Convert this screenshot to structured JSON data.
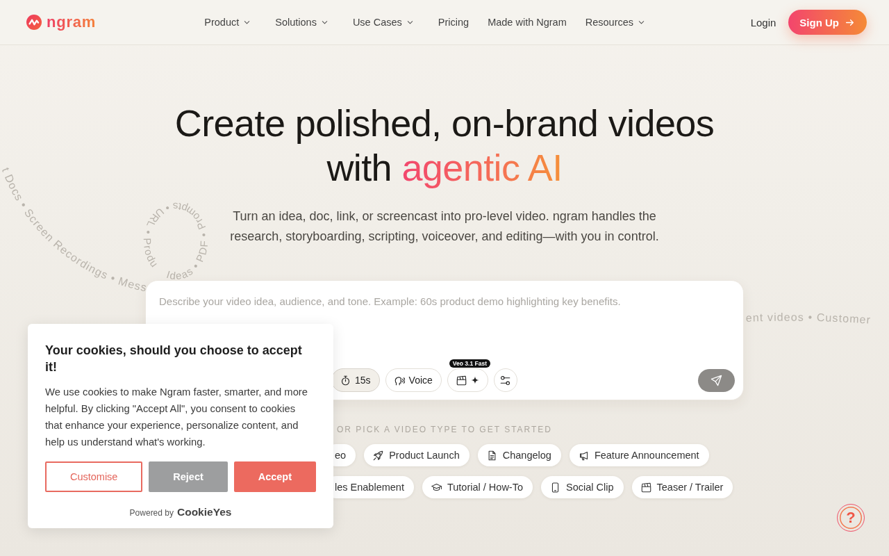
{
  "header": {
    "logo": "ngram",
    "nav": [
      {
        "label": "Product",
        "dropdown": true
      },
      {
        "label": "Solutions",
        "dropdown": true
      },
      {
        "label": "Use Cases",
        "dropdown": true
      },
      {
        "label": "Pricing",
        "dropdown": false
      },
      {
        "label": "Made with Ngram",
        "dropdown": false
      },
      {
        "label": "Resources",
        "dropdown": true
      }
    ],
    "login": "Login",
    "signup": "Sign Up"
  },
  "hero": {
    "title": "Create polished, on-brand videos with",
    "title_accent": "agentic AI",
    "subtitle": "Turn an idea, doc, link, or screencast into pro-level video. ngram handles the research, storyboarding, scripting, voiceover, and editing—with you in control."
  },
  "background_captions": [
    {
      "kind": "arc",
      "text": "t Docs • Screen Recordings • Mess"
    },
    {
      "kind": "loop",
      "text": "Ideas • PDF • Prompts • URL • Produ"
    },
    {
      "kind": "tail",
      "text": "ent videos • Customer"
    }
  ],
  "prompt_box": {
    "placeholder": "Describe your video idea, audience, and tone. Example: 60s product demo highlighting key benefits.",
    "tools": [
      {
        "kind": "duration",
        "label": "15s",
        "selected": true
      },
      {
        "kind": "voice",
        "label": "Voice",
        "selected": false
      },
      {
        "kind": "model",
        "badge": "Veo 3.1 Fast",
        "selected": false
      },
      {
        "kind": "settings",
        "selected": false
      }
    ],
    "send_disabled": true
  },
  "video_types": {
    "heading": "OR PICK A VIDEO TYPE TO GET STARTED",
    "rows": [
      {
        "chips": [
          {
            "kind": "cut",
            "label": "eo"
          },
          {
            "kind": "launch",
            "label": "Product Launch"
          },
          {
            "kind": "changelog",
            "label": "Changelog"
          },
          {
            "kind": "announcement",
            "label": "Feature Announcement"
          }
        ]
      },
      {
        "chips": [
          {
            "kind": "cut",
            "label": "les Enablement"
          },
          {
            "kind": "tutorial",
            "label": "Tutorial / How-To"
          },
          {
            "kind": "social",
            "label": "Social Clip"
          },
          {
            "kind": "teaser",
            "label": "Teaser / Trailer"
          }
        ]
      }
    ]
  },
  "cookie_banner": {
    "title": "Your cookies, should you choose to accept it!",
    "body": "We use cookies to make Ngram faster, smarter, and more helpful. By clicking \"Accept All\", you consent to cookies that enhance your experience, personalize content, and help us understand what's working.",
    "buttons": [
      {
        "kind": "outline",
        "label": "Customise"
      },
      {
        "kind": "neutral",
        "label": "Reject"
      },
      {
        "kind": "primary",
        "label": "Accept"
      }
    ],
    "powered_by": "Powered by",
    "brand": "CookieYes"
  },
  "help_button": {
    "label": "?"
  }
}
